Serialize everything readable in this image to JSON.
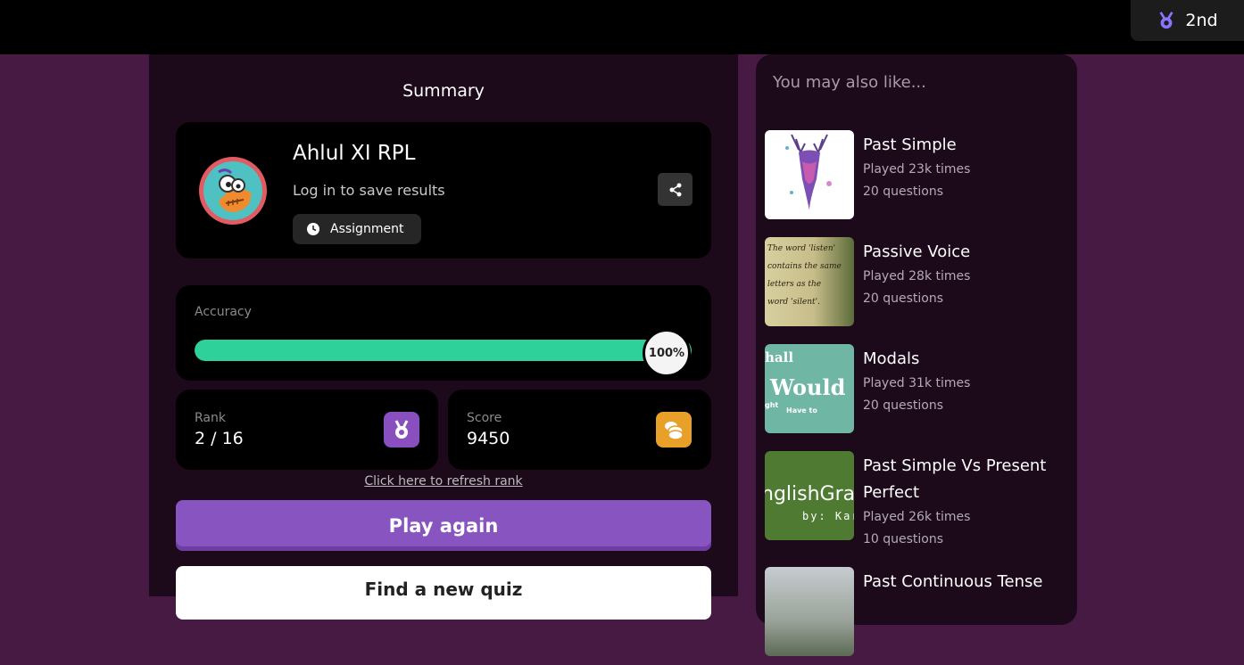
{
  "topbar": {
    "rank_position": "2nd"
  },
  "summary": {
    "title": "Summary",
    "player_name": "Ahlul XI RPL",
    "login_prompt": "Log in to save results",
    "mode_label": "Assignment"
  },
  "accuracy": {
    "label": "Accuracy",
    "value_text": "100%",
    "value_percent": 100
  },
  "rank": {
    "label": "Rank",
    "value": "2 / 16"
  },
  "score": {
    "label": "Score",
    "value": "9450"
  },
  "refresh_link": "Click here to refresh rank",
  "buttons": {
    "play_again": "Play again",
    "find_new": "Find a new quiz"
  },
  "recommendations": {
    "title": "You may also like...",
    "items": [
      {
        "title": "Past Simple",
        "played": "Played 23k times",
        "questions": "20 questions"
      },
      {
        "title": "Passive Voice",
        "played": "Played 28k times",
        "questions": "20 questions",
        "thumb_text": [
          "The word 'listen'",
          "contains the same",
          "letters as the",
          "word 'silent'."
        ]
      },
      {
        "title": "Modals",
        "played": "Played 31k times",
        "questions": "20 questions",
        "thumb_text": [
          "hall",
          "Would",
          "ght",
          "Have to"
        ]
      },
      {
        "title": "Past Simple Vs Present Perfect",
        "played": "Played 26k times",
        "questions": "10 questions",
        "thumb_text": [
          "nglishGra",
          "by: Kar"
        ]
      },
      {
        "title": "Past Continuous Tense",
        "played": "",
        "questions": ""
      }
    ]
  },
  "colors": {
    "accent_purple": "#8854c0",
    "accuracy_green": "#2fd19a",
    "score_gold": "#f5a623",
    "rank_purple": "#8a4fbf"
  }
}
